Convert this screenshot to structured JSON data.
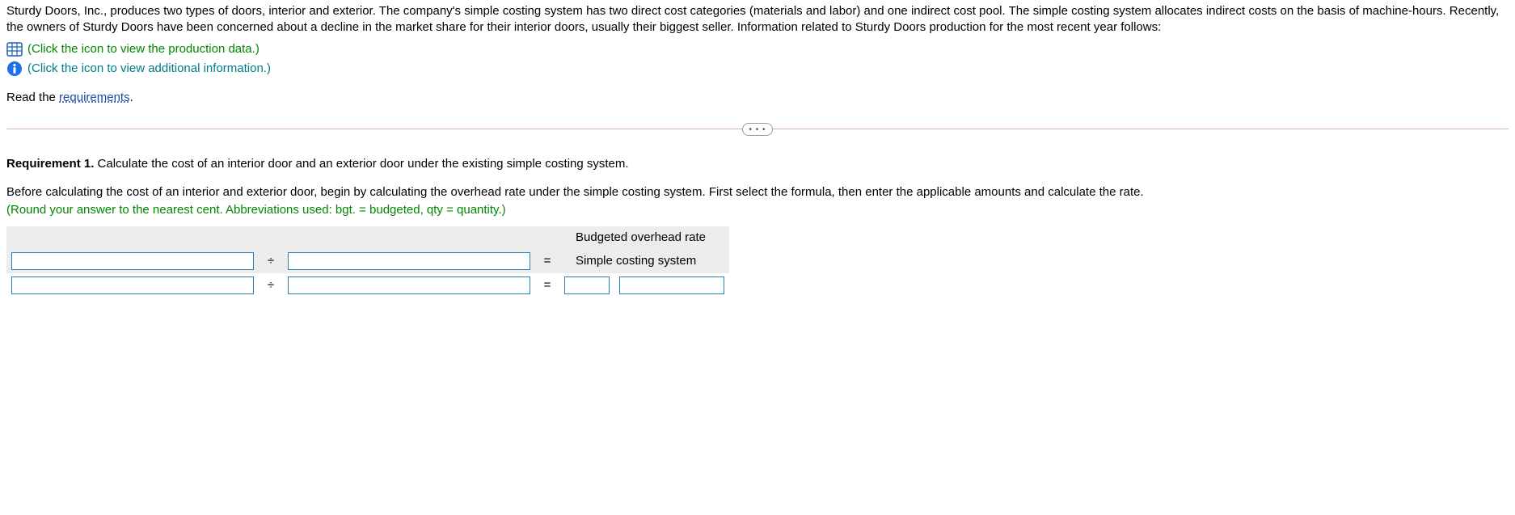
{
  "intro": "Sturdy Doors, Inc., produces two types of doors, interior and exterior. The company's simple costing system has two direct cost categories (materials and labor) and one indirect cost pool. The simple costing system allocates indirect costs on the basis of machine-hours. Recently, the owners of Sturdy Doors have been concerned about a decline in the market share for their interior doors, usually their biggest seller. Information related to Sturdy Doors production for the most recent year follows:",
  "link1": "(Click the icon to view the production data.)",
  "link2": "(Click the icon to view additional information.)",
  "read_prefix": "Read the ",
  "read_link": "requirements",
  "read_suffix": ".",
  "req1_label": "Requirement 1.",
  "req1_text": " Calculate the cost of an interior door and an exterior door under the existing simple costing system.",
  "instruction": "Before calculating the cost of an interior and exterior door, begin by calculating the overhead rate under the simple costing system. First select the formula, then enter the applicable amounts and calculate the rate.",
  "hint": "(Round your answer to the nearest cent. Abbreviations used: bgt. = budgeted, qty = quantity.)",
  "table": {
    "col_header": "Budgeted overhead rate",
    "row_label": "Simple costing system",
    "divide": "÷",
    "equals": "="
  },
  "pill": "• • •"
}
